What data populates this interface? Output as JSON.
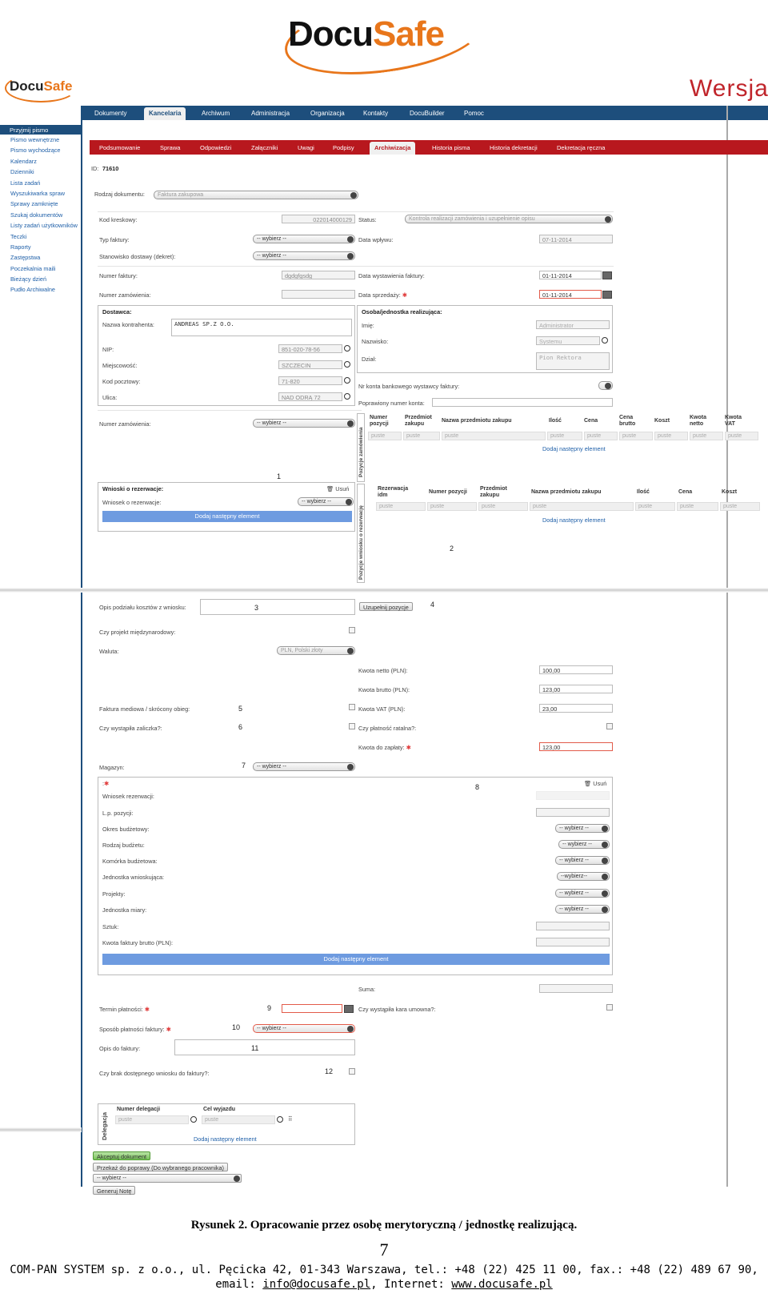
{
  "brand": {
    "logo_a": "Docu",
    "logo_b": "Safe",
    "version_text": "Wersja"
  },
  "topnav": [
    "Dokumenty",
    "Kancelaria",
    "Archiwum",
    "Administracja",
    "Organizacja",
    "Kontakty",
    "DocuBuilder",
    "Pomoc"
  ],
  "sidebar": {
    "header": "Przyjmij pismo",
    "items": [
      "Pismo wewnętrzne",
      "Pismo wychodzące",
      "Kalendarz",
      "Dzienniki",
      "Lista zadań",
      "Wyszukiwarka spraw",
      "Sprawy zamknięte",
      "Szukaj dokumentów",
      "Listy zadań użytkowników",
      "Teczki",
      "Raporty",
      "Zastępstwa",
      "Poczekalnia maili",
      "Bieżący dzień",
      "Pudło Archiwalne"
    ]
  },
  "subnav": [
    "Podsumowanie",
    "Sprawa",
    "Odpowiedzi",
    "Załączniki",
    "Uwagi",
    "Podpisy",
    "Archiwizacja",
    "Historia pisma",
    "Historia dekretacji",
    "Dekretacja ręczna"
  ],
  "form": {
    "id_label": "ID:",
    "id_value": "71610",
    "rodzaj_label": "Rodzaj dokumentu:",
    "rodzaj_value": "Faktura zakupowa",
    "kod_label": "Kod kreskowy:",
    "kod_value": "022014000129",
    "status_label": "Status:",
    "status_value": "Kontrola realizacji zamówienia i uzupełnienie opisu",
    "typ_label": "Typ faktury:",
    "wybierz": "-- wybierz --",
    "wybierz2": "--wybierz--",
    "data_wplywu_label": "Data wpływu:",
    "data_wplywu": "07-11-2014",
    "stanowisko_label": "Stanowisko dostawy (dekret):",
    "numer_faktury_label": "Numer faktury:",
    "numer_faktury": "dgdgfgsdg",
    "data_wyst_label": "Data wystawienia faktury:",
    "data_wyst": "01-11-2014",
    "numer_zam_label": "Numer zamówienia:",
    "data_sprz_label": "Data sprzedaży:",
    "data_sprz": "01-11-2014",
    "dostawca_title": "Dostawca:",
    "nazwa_kontr_label": "Nazwa kontrahenta:",
    "nazwa_kontr": "ANDREAS SP.Z O.O.",
    "nip_label": "NIP:",
    "nip": "851-020-78-56",
    "miejsc_label": "Miejscowość:",
    "miejsc": "SZCZECIN",
    "kod_poczt_label": "Kod pocztowy:",
    "kod_poczt": "71-820",
    "ulica_label": "Ulica:",
    "ulica": "NAD ODRĄ 72",
    "osoba_title": "Osoba/jednostka realizująca:",
    "imie_label": "Imię:",
    "imie": "Administrator",
    "nazwisko_label": "Nazwisko:",
    "nazwisko": "Systemu",
    "dzial_label": "Dział:",
    "dzial": "Pion Rektora",
    "konto_label": "Nr konta bankowego wystawcy faktury:",
    "popr_konto_label": "Poprawiony numer konta:",
    "numer_zam2_label": "Numer zamówienia:",
    "poz_zam_vert": "Pozycje zamówienia",
    "poz_zam_headers": [
      "Numer pozycji",
      "Przedmiot zakupu",
      "Nazwa przedmiotu zakupu",
      "Ilość",
      "Cena",
      "Cena brutto",
      "Koszt",
      "Kwota netto",
      "Kwota VAT"
    ],
    "puste": "puste",
    "dodaj_el": "Dodaj następny element",
    "wnioski_title": "Wnioski o rezerwacje:",
    "usun": "Usuń",
    "wniosek_label": "Wniosek o rezerwacje:",
    "dodaj_bar": "Dodaj następny element",
    "poz_wn_vert": "Pozycje wniosku o rezerwację",
    "poz_wn_headers": [
      "Rezerwacja idm",
      "Numer pozycji",
      "Przedmiot zakupu",
      "Nazwa przedmiotu zakupu",
      "Ilość",
      "Cena",
      "Koszt"
    ],
    "opis_label": "Opis podziału kosztów z wniosku:",
    "uzupelnij": "Uzupełnij pozycje",
    "projekt_label": "Czy projekt międzynarodowy:",
    "waluta_label": "Waluta:",
    "waluta": "PLN, Polski złoty",
    "netto_label": "Kwota netto (PLN):",
    "netto": "100,00",
    "brutto_label": "Kwota brutto (PLN):",
    "brutto": "123,00",
    "medialna_label": "Faktura mediowa / skrócony obieg:",
    "vat_label": "Kwota VAT (PLN):",
    "vat": "23,00",
    "zaliczka_label": "Czy wystąpiła zaliczka?:",
    "ratalna_label": "Czy płatność ratalna?:",
    "do_zaplaty_label": "Kwota do zapłaty:",
    "do_zaplaty": "123,00",
    "magazyn_label": "Magazyn:",
    "rez_title": ":",
    "wn_rez_label": "Wniosek rezerwacji:",
    "lp_label": "L.p. pozycji:",
    "okres_label": "Okres budżetowy:",
    "rodzaj_b_label": "Rodzaj budżetu:",
    "komorka_label": "Komórka budżetowa:",
    "jedn_wn_label": "Jednostka wnioskująca:",
    "projekty_label": "Projekty:",
    "jedn_miary_label": "Jednostka miary:",
    "sztuk_label": "Sztuk:",
    "kwota_fb_label": "Kwota faktury brutto (PLN):",
    "suma_label": "Suma:",
    "termin_label": "Termin płatności:",
    "kara_label": "Czy wystąpiła kara umowna?:",
    "sposob_label": "Sposób płatności faktury:",
    "opis_fakt_label": "Opis do faktury:",
    "brak_label": "Czy brak dostępnego wniosku do faktury?:",
    "deleg_vert": "Delegacja",
    "deleg_nr": "Numer delegacji",
    "deleg_cel": "Cel wyjazdu",
    "akceptuj": "Akceptuj dokument",
    "przekaz": "Przekaż do poprawy (Do wybranego pracownika)",
    "generuj": "Generuj Notę"
  },
  "markers": [
    "1",
    "2",
    "3",
    "4",
    "5",
    "6",
    "7",
    "8",
    "9",
    "10",
    "11",
    "12"
  ],
  "caption": "Rysunek 2. Opracowanie przez osobę merytoryczną / jednostkę realizującą.",
  "page_number": "7",
  "footer": {
    "line1": "COM-PAN SYSTEM sp. z o.o., ul. Pęcicka 42, 01-343 Warszawa, tel.: +48 (22) 425 11 00, fax.: +48 (22) 489 67 90,",
    "email_label": "email: ",
    "email": "info@docusafe.pl",
    "internet_label": ", Internet: ",
    "www": "www.docusafe.pl"
  }
}
